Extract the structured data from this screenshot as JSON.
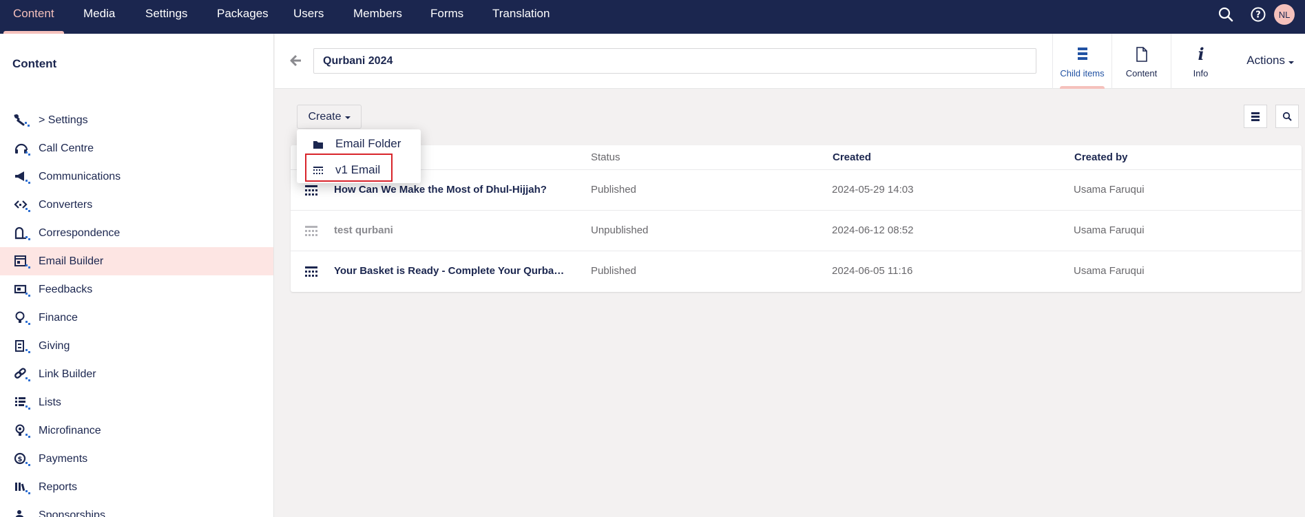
{
  "topbar": {
    "sections": [
      "Content",
      "Media",
      "Settings",
      "Packages",
      "Users",
      "Members",
      "Forms",
      "Translation"
    ],
    "active_section": "Content",
    "avatar_initials": "NL",
    "search_icon": "search-icon",
    "help_icon": "help-icon"
  },
  "sidebar": {
    "title": "Content",
    "items": [
      {
        "label": "> Settings",
        "icon": "wrench-icon"
      },
      {
        "label": "Call Centre",
        "icon": "headset-icon"
      },
      {
        "label": "Communications",
        "icon": "megaphone-icon"
      },
      {
        "label": "Converters",
        "icon": "converter-icon"
      },
      {
        "label": "Correspondence",
        "icon": "mailbox-icon"
      },
      {
        "label": "Email Builder",
        "icon": "email-builder-icon"
      },
      {
        "label": "Feedbacks",
        "icon": "feedback-icon"
      },
      {
        "label": "Finance",
        "icon": "finance-icon"
      },
      {
        "label": "Giving",
        "icon": "giving-icon"
      },
      {
        "label": "Link Builder",
        "icon": "link-icon"
      },
      {
        "label": "Lists",
        "icon": "list-icon"
      },
      {
        "label": "Microfinance",
        "icon": "microfinance-icon"
      },
      {
        "label": "Payments",
        "icon": "payments-icon"
      },
      {
        "label": "Reports",
        "icon": "reports-icon"
      },
      {
        "label": "Sponsorships",
        "icon": "sponsorship-icon"
      }
    ],
    "active_item": "Email Builder"
  },
  "editor": {
    "node_name": "Qurbani 2024",
    "tabs": [
      {
        "label": "Child items",
        "icon": "child-items-icon"
      },
      {
        "label": "Content",
        "icon": "document-icon"
      },
      {
        "label": "Info",
        "icon": "info-icon"
      }
    ],
    "active_tab": "Child items",
    "actions_label": "Actions"
  },
  "listview": {
    "create_label": "Create",
    "columns": [
      "Status",
      "Created",
      "Created by"
    ],
    "rows": [
      {
        "name": "How Can We Make the Most of Dhul-Hijjah?",
        "status": "Published",
        "created": "2024-05-29 14:03",
        "created_by": "Usama Faruqui"
      },
      {
        "name": "test qurbani",
        "status": "Unpublished",
        "created": "2024-06-12 08:52",
        "created_by": "Usama Faruqui"
      },
      {
        "name": "Your Basket is Ready - Complete Your Qurbani Today",
        "status": "Published",
        "created": "2024-06-05 11:16",
        "created_by": "Usama Faruqui"
      }
    ]
  },
  "create_menu": {
    "items": [
      {
        "label": "Email Folder",
        "icon": "folder-icon"
      },
      {
        "label": "v1 Email",
        "icon": "email-grid-icon"
      }
    ],
    "highlighted": "v1 Email"
  },
  "colors": {
    "topbar": "#1b264f",
    "accent": "#f5c1bc",
    "active_item_bg": "#fde5e3",
    "highlight_border": "#d8232a",
    "link_blue": "#2152a3"
  }
}
